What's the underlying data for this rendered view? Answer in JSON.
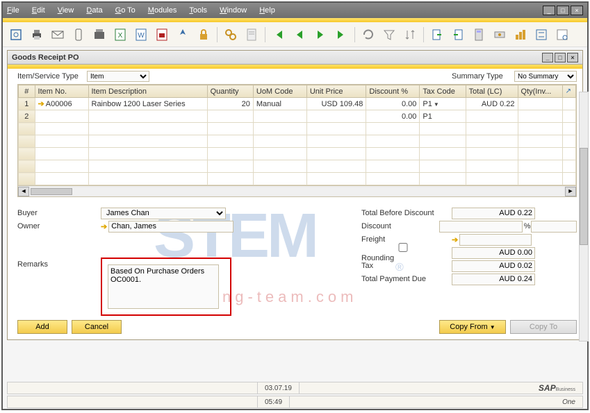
{
  "menus": [
    "File",
    "Edit",
    "View",
    "Data",
    "Go To",
    "Modules",
    "Tools",
    "Window",
    "Help"
  ],
  "subwin_title": "Goods Receipt PO",
  "item_service_label": "Item/Service Type",
  "item_service_value": "Item",
  "summary_type_label": "Summary Type",
  "summary_type_value": "No Summary",
  "columns": [
    "#",
    "Item No.",
    "Item Description",
    "Quantity",
    "UoM Code",
    "Unit Price",
    "Discount %",
    "Tax Code",
    "Total (LC)",
    "Qty(Inv..."
  ],
  "rows": [
    {
      "n": "1",
      "item": "A00006",
      "desc": "Rainbow 1200 Laser Series",
      "qty": "20",
      "uom": "Manual",
      "price": "USD 109.48",
      "disc": "0.00",
      "tax": "P1",
      "total": "AUD 0.22",
      "qtyinv": ""
    },
    {
      "n": "2",
      "item": "",
      "desc": "",
      "qty": "",
      "uom": "",
      "price": "",
      "disc": "0.00",
      "tax": "P1",
      "total": "",
      "qtyinv": ""
    }
  ],
  "buyer_label": "Buyer",
  "buyer_value": "James Chan",
  "owner_label": "Owner",
  "owner_value": "Chan, James",
  "remarks_label": "Remarks",
  "remarks_text": "Based On Purchase Orders OC0001.",
  "totals": {
    "before_label": "Total Before Discount",
    "before": "AUD 0.22",
    "discount_label": "Discount",
    "discount_pct": "",
    "pct_sym": "%",
    "discount_val": "",
    "freight_label": "Freight",
    "freight": "",
    "rounding_label": "Rounding",
    "rounding": "AUD 0.00",
    "tax_label": "Tax",
    "tax": "AUD 0.02",
    "due_label": "Total Payment Due",
    "due": "AUD 0.24"
  },
  "buttons": {
    "add": "Add",
    "cancel": "Cancel",
    "copyfrom": "Copy From",
    "copyto": "Copy To"
  },
  "status": {
    "date": "03.07.19",
    "time": "05:49"
  },
  "brand": {
    "main": "SAP",
    "sup": "Business",
    "sub": "One"
  }
}
